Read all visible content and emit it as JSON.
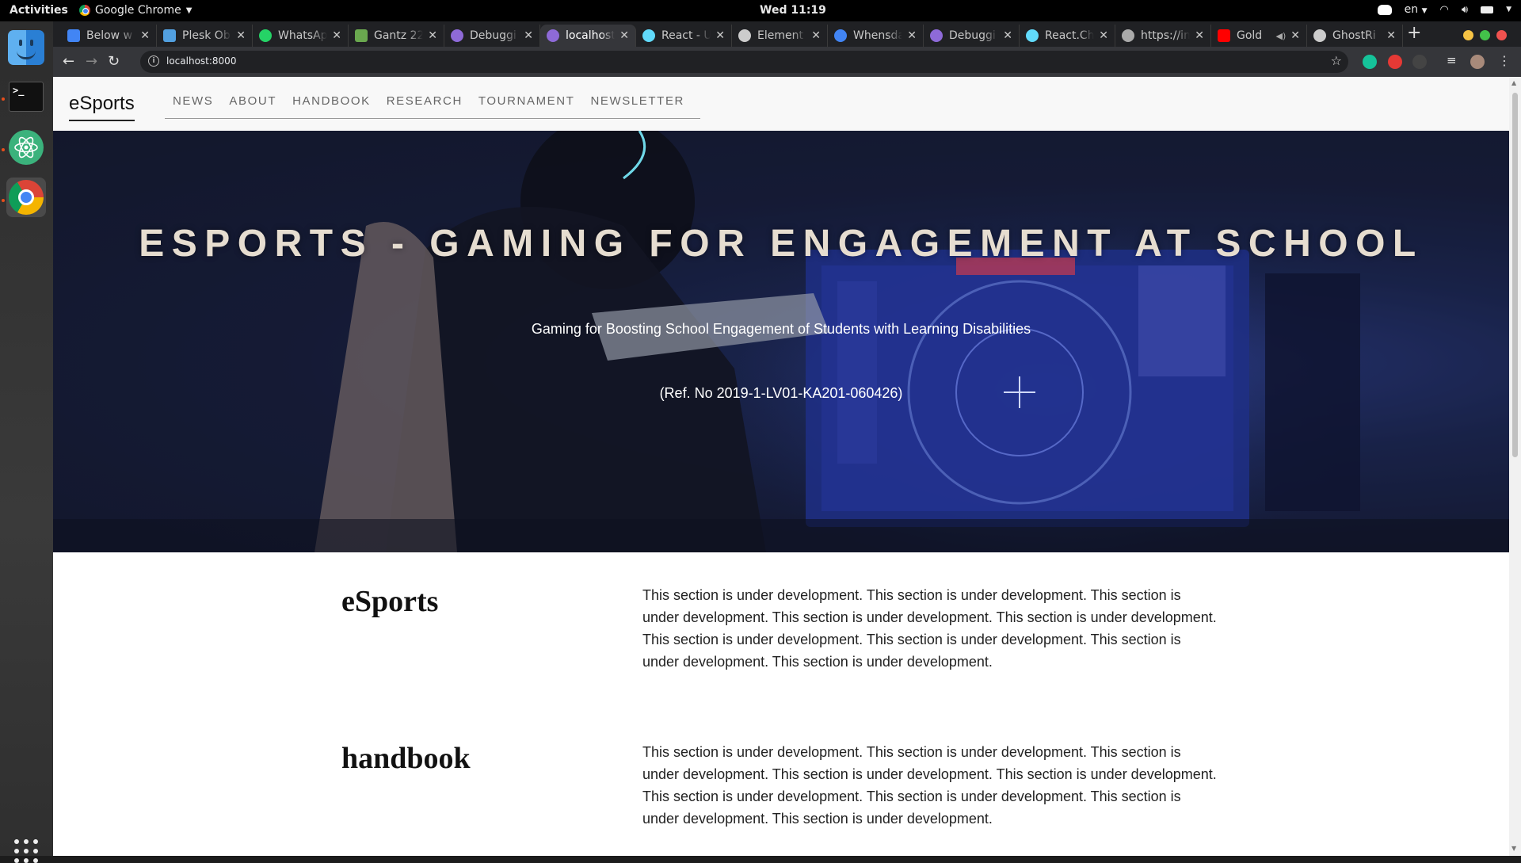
{
  "system": {
    "activities": "Activities",
    "app_name": "Google Chrome",
    "clock": "Wed 11:19",
    "lang": "en"
  },
  "browser": {
    "tabs": [
      {
        "title": "Below w",
        "color": "#4285f4"
      },
      {
        "title": "Plesk Ob",
        "color": "#52a0e0"
      },
      {
        "title": "WhatsAp",
        "color": "#25d366"
      },
      {
        "title": "Gantz 22",
        "color": "#6aa84f"
      },
      {
        "title": "Debuggi",
        "color": "#8e6ad8"
      },
      {
        "title": "localhost",
        "color": "#8e6ad8"
      },
      {
        "title": "React - U",
        "color": "#61dafb"
      },
      {
        "title": "Element",
        "color": "#cccccc"
      },
      {
        "title": "Whensda",
        "color": "#4285f4"
      },
      {
        "title": "Debuggi",
        "color": "#8e6ad8"
      },
      {
        "title": "React.Ch",
        "color": "#61dafb"
      },
      {
        "title": "https://im",
        "color": "#aaaaaa"
      },
      {
        "title": "Gold",
        "color": "#ff0000"
      },
      {
        "title": "GhostRi",
        "color": "#cccccc"
      }
    ],
    "active_tab_index": 5,
    "url": "localhost:8000"
  },
  "site": {
    "brand": "eSports",
    "nav": [
      "NEWS",
      "ABOUT",
      "HANDBOOK",
      "RESEARCH",
      "TOURNAMENT",
      "NEWSLETTER"
    ],
    "hero": {
      "title": "ESPORTS - GAMING FOR ENGAGEMENT AT SCHOOL",
      "subtitle": "Gaming for Boosting School Engagement of Students with Learning Disabilities",
      "ref": "(Ref. No 2019-1-LV01-KA201-060426)"
    },
    "sections": [
      {
        "heading": "eSports",
        "body": "This section is under development. This section is under development. This section is under development. This section is under development. This section is under development. This section is under development. This section is under development. This section is under development. This section is under development."
      },
      {
        "heading": "handbook",
        "body": "This section is under development. This section is under development. This section is under development. This section is under development. This section is under development. This section is under development. This section is under development. This section is under development. This section is under development."
      }
    ]
  }
}
